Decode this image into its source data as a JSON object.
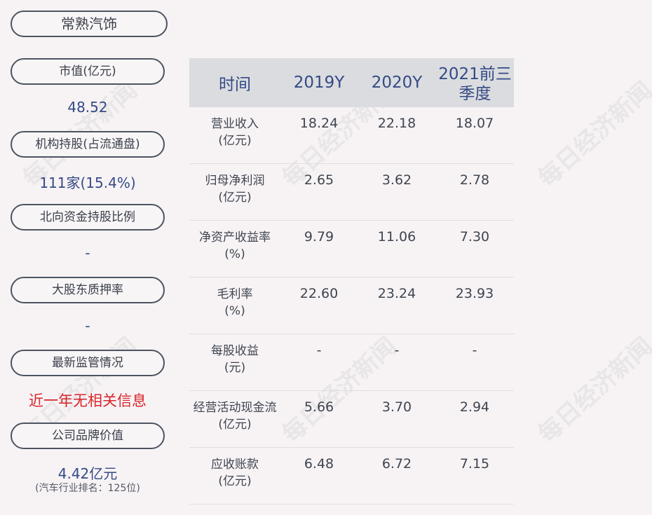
{
  "company": "常熟汽饰",
  "side": {
    "market_cap_label": "市值(亿元)",
    "market_cap_value": "48.52",
    "institution_label": "机构持股(占流通盘)",
    "institution_value": "111家(15.4%)",
    "northbound_label": "北向资金持股比例",
    "northbound_value": "-",
    "pledge_label": "大股东质押率",
    "pledge_value": "-",
    "regulation_label": "最新监管情况",
    "regulation_value": "近一年无相关信息",
    "brand_label": "公司品牌价值",
    "brand_value": "4.42亿元",
    "brand_note": "(汽车行业排名：125位)"
  },
  "table": {
    "headers": [
      "时间",
      "2019Y",
      "2020Y",
      "2021前三季度"
    ],
    "rows": [
      {
        "label": "营业收入\n(亿元)",
        "values": [
          "18.24",
          "22.18",
          "18.07"
        ]
      },
      {
        "label": "归母净利润\n(亿元)",
        "values": [
          "2.65",
          "3.62",
          "2.78"
        ]
      },
      {
        "label": "净资产收益率\n(%)",
        "values": [
          "9.79",
          "11.06",
          "7.30"
        ]
      },
      {
        "label": "毛利率\n(%)",
        "values": [
          "22.60",
          "23.24",
          "23.93"
        ]
      },
      {
        "label": "每股收益\n(元)",
        "values": [
          "-",
          "-",
          "-"
        ]
      },
      {
        "label": "经营活动现金流\n(亿元)",
        "values": [
          "5.66",
          "3.70",
          "2.94"
        ]
      },
      {
        "label": "应收账款\n(亿元)",
        "values": [
          "6.48",
          "6.72",
          "7.15"
        ]
      }
    ]
  },
  "watermark": "每日经济新闻",
  "colors": {
    "accent": "#354a86",
    "alert": "#d8262b",
    "header_bg": "#dadcdf"
  }
}
